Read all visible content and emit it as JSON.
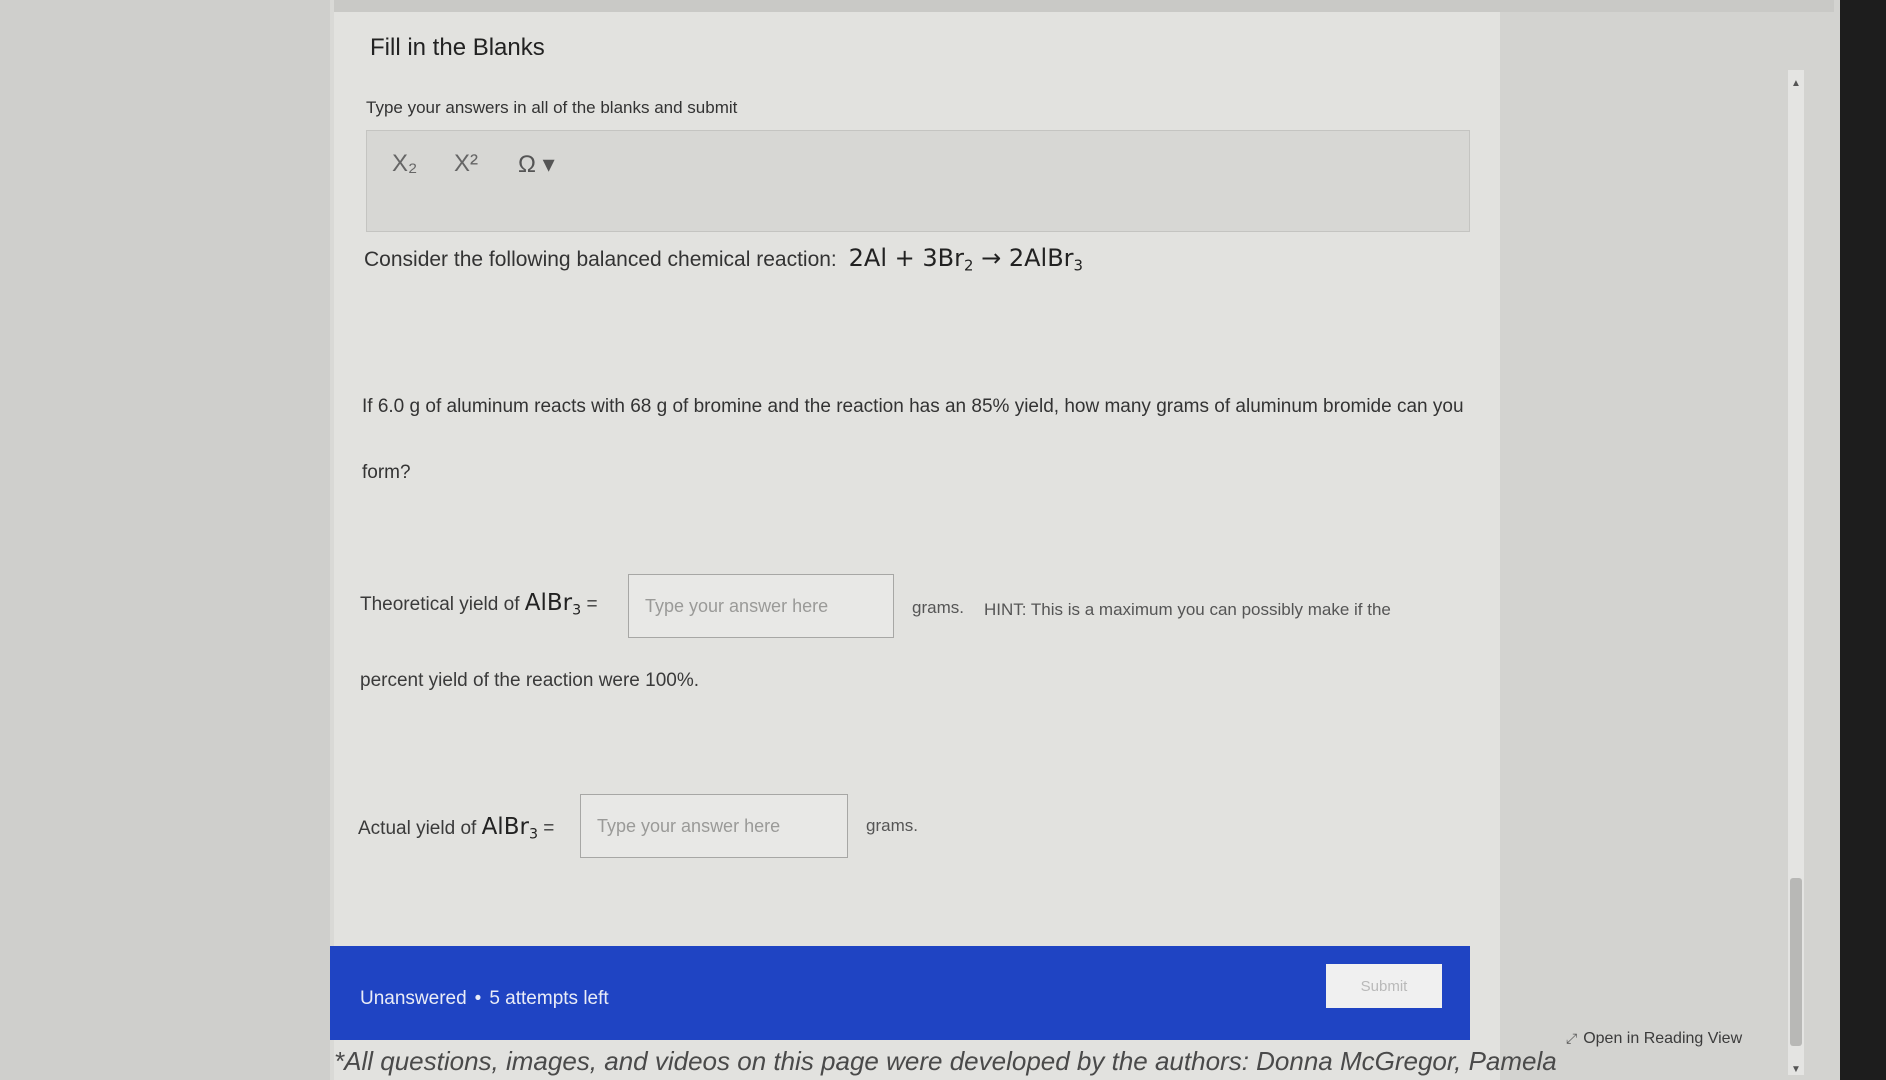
{
  "question": {
    "title": "Fill in the Blanks",
    "instructions": "Type your answers in all of the blanks and submit",
    "reaction_prefix": "Consider the following balanced chemical reaction:",
    "reaction": {
      "lhs1": "2Al",
      "plus": "+",
      "lhs2": "3Br",
      "lhs2_sub": "2",
      "arrow": "→",
      "rhs": "2AlBr",
      "rhs_sub": "3"
    },
    "prompt_line1": "If 6.0 g of aluminum reacts with 68 g of bromine and the reaction has an 85% yield, how many grams of aluminum bromide can you",
    "prompt_line2": "form?"
  },
  "toolbar": {
    "subscript": "X₂",
    "superscript": "X²",
    "special_chars": "Ω ▾"
  },
  "blank1": {
    "label": "Theoretical yield of",
    "formula": "AlBr",
    "formula_sub": "3",
    "equals": "=",
    "placeholder": "Type your answer here",
    "unit": "grams.",
    "hint": "HINT: This is a maximum you can possibly make if the",
    "hint_cont": "percent yield of the reaction were 100%."
  },
  "blank2": {
    "label": "Actual yield of",
    "formula": "AlBr",
    "formula_sub": "3",
    "equals": "=",
    "placeholder": "Type your answer here",
    "unit": "grams."
  },
  "status": {
    "state": "Unanswered",
    "separator": "•",
    "attempts": "5 attempts left",
    "submit_label": "Submit"
  },
  "footer": {
    "note": "*All questions, images, and videos on this page were developed by the authors: Donna McGregor, Pamela",
    "reading_view": "Open in Reading View",
    "reading_view_icon": "expand-icon"
  },
  "colors": {
    "status_bar": "#1f44c3",
    "page_bg": "#e2e2df"
  }
}
